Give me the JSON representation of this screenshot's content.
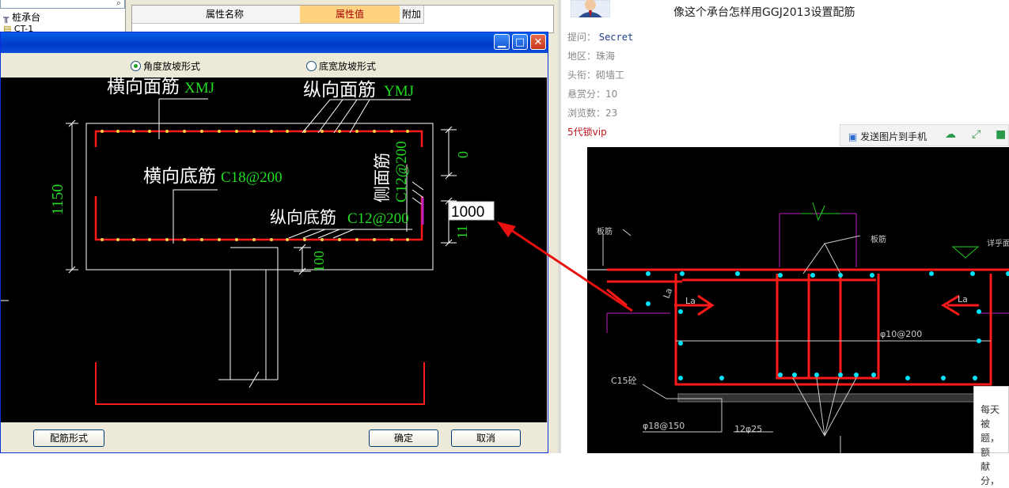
{
  "background_app": {
    "tree": {
      "search_value": "",
      "nodes": [
        "桩承台",
        "CT-1"
      ]
    },
    "property_table": {
      "columns": [
        "属性名称",
        "属性值",
        "附加"
      ]
    }
  },
  "dialog": {
    "radios": [
      {
        "label": "角度放坡形式",
        "checked": true
      },
      {
        "label": "底宽放坡形式",
        "checked": false
      }
    ],
    "drawing": {
      "label_top_transverse": "横向面筋",
      "label_top_transverse_code": "XMJ",
      "label_top_longitudinal": "纵向面筋",
      "label_top_longitudinal_code": "YMJ",
      "label_bottom_transverse": "横向底筋",
      "label_bottom_transverse_code": "C18@200",
      "label_bottom_longitudinal": "纵向底筋",
      "label_bottom_longitudinal_code": "C12@200",
      "label_side": "侧面筋",
      "label_side_code": "C12@200",
      "dim_height": "1150",
      "dim_top_right": "0",
      "dim_bottom": "100",
      "dim_right_partial": "11",
      "edit_value": "1000"
    },
    "buttons": {
      "rebar_form": "配筋形式",
      "ok": "确定",
      "cancel": "取消"
    }
  },
  "forum": {
    "question_title": "像这个承台怎样用GGJ2013设置配筋",
    "asker_label": "提问：",
    "asker_name": "Secret",
    "region_label": "地区：",
    "region_value": "珠海",
    "title_label": "头衔：",
    "title_value": "砌墙工",
    "bounty_label": "悬赏分：",
    "bounty_value": "10",
    "views_label": "浏览数：",
    "views_value": "23",
    "vip_badge": "5代锁vip",
    "toolbar": {
      "send_label": "发送图片到手机"
    },
    "cad": {
      "label_slab_rebar_left": "板筋",
      "label_slab_rebar_mid": "板筋",
      "label_detail": "详乎面",
      "label_la1": "La",
      "label_la2": "La",
      "label_la3": "La",
      "label_stirrup": "φ10@200",
      "label_concrete": "C15砼",
      "label_bottom_bar": "φ18@150",
      "label_bottom_bar2": "12φ25"
    },
    "popup_lines": [
      "每天被",
      "题，额",
      "献分，"
    ]
  },
  "colors": {
    "rebar_red": "#ff1a1a",
    "label_green": "#22dd22",
    "dot_yellow": "#ffd24a",
    "cad_cyan": "#00e5ff",
    "cad_magenta": "#c020c0",
    "arrow_red": "#e81010"
  }
}
